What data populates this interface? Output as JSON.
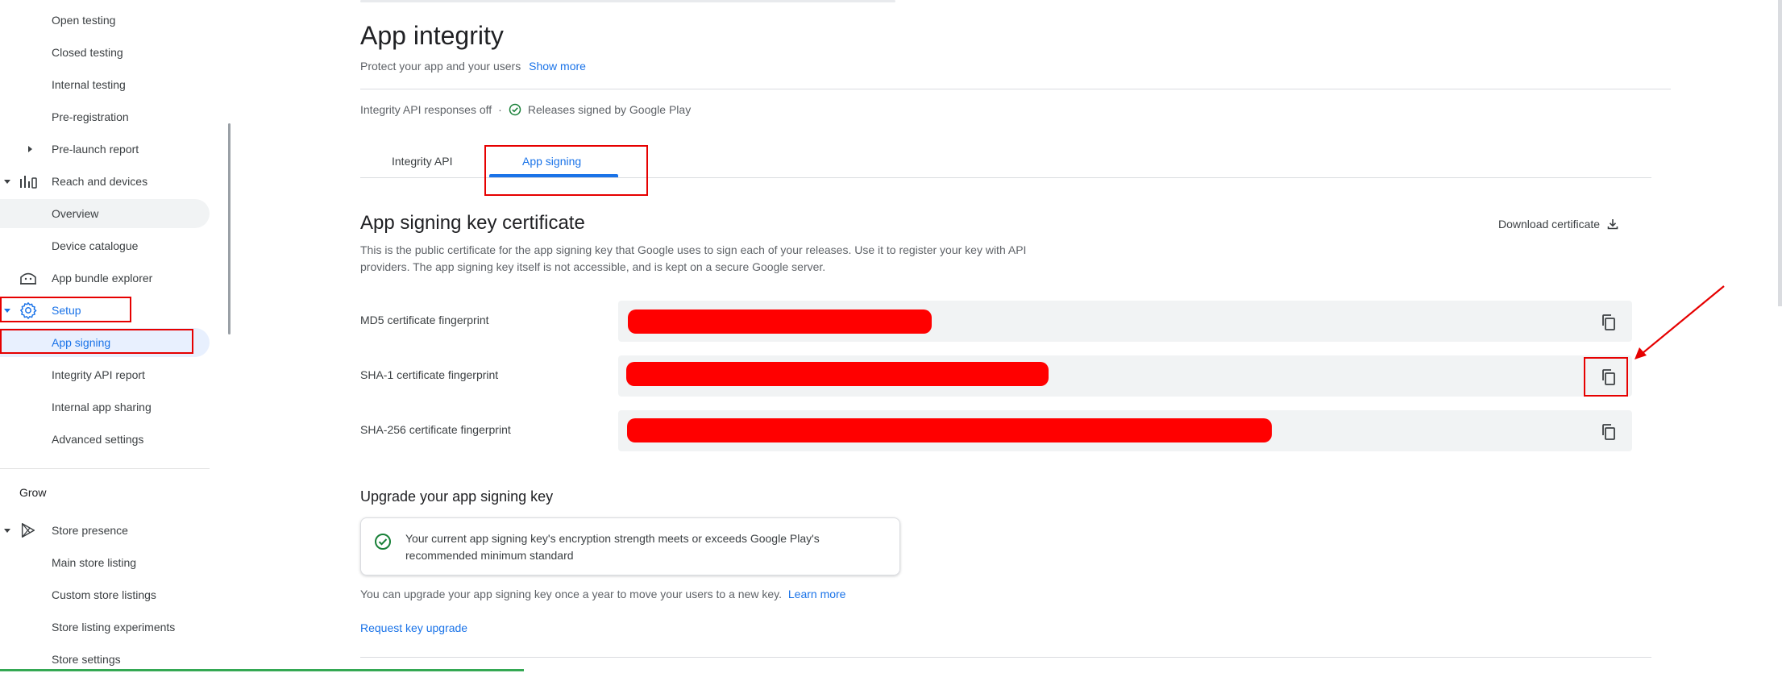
{
  "sidebar": {
    "items": [
      {
        "label": "Open testing"
      },
      {
        "label": "Closed testing"
      },
      {
        "label": "Internal testing"
      },
      {
        "label": "Pre-registration"
      },
      {
        "label": "Pre-launch report"
      },
      {
        "label": "Reach and devices",
        "icon": "bar-chart-icon"
      },
      {
        "label": "Overview"
      },
      {
        "label": "Device catalogue"
      },
      {
        "label": "App bundle explorer",
        "icon": "app-bundle-icon"
      },
      {
        "label": "Setup",
        "icon": "gear-icon"
      },
      {
        "label": "App signing"
      },
      {
        "label": "Integrity API report"
      },
      {
        "label": "Internal app sharing"
      },
      {
        "label": "Advanced settings"
      },
      {
        "label": "Grow"
      },
      {
        "label": "Store presence",
        "icon": "play-store-icon"
      },
      {
        "label": "Main store listing"
      },
      {
        "label": "Custom store listings"
      },
      {
        "label": "Store listing experiments"
      },
      {
        "label": "Store settings"
      }
    ]
  },
  "page": {
    "title": "App integrity",
    "subtitle": "Protect your app and your users",
    "show_more": "Show more",
    "status_api": "Integrity API responses off",
    "status_sep": "·",
    "status_signed": "Releases signed by Google Play"
  },
  "tabs": [
    {
      "label": "Integrity API"
    },
    {
      "label": "App signing",
      "active": true
    }
  ],
  "certificate": {
    "heading": "App signing key certificate",
    "description": "This is the public certificate for the app signing key that Google uses to sign each of your releases. Use it to register your key with API providers. The app signing key itself is not accessible, and is kept on a secure Google server.",
    "download_label": "Download certificate",
    "fingerprints": [
      {
        "label": "MD5 certificate fingerprint"
      },
      {
        "label": "SHA-1 certificate fingerprint"
      },
      {
        "label": "SHA-256 certificate fingerprint"
      }
    ]
  },
  "upgrade": {
    "heading": "Upgrade your app signing key",
    "card_message": "Your current app signing key's encryption strength meets or exceeds Google Play's recommended minimum standard",
    "note": "You can upgrade your app signing key once a year to move your users to a new key.",
    "learn_more": "Learn more",
    "request_label": "Request key upgrade"
  },
  "colors": {
    "accent": "#1a73e8",
    "success": "#188038",
    "annotation_red": "#e60000"
  }
}
